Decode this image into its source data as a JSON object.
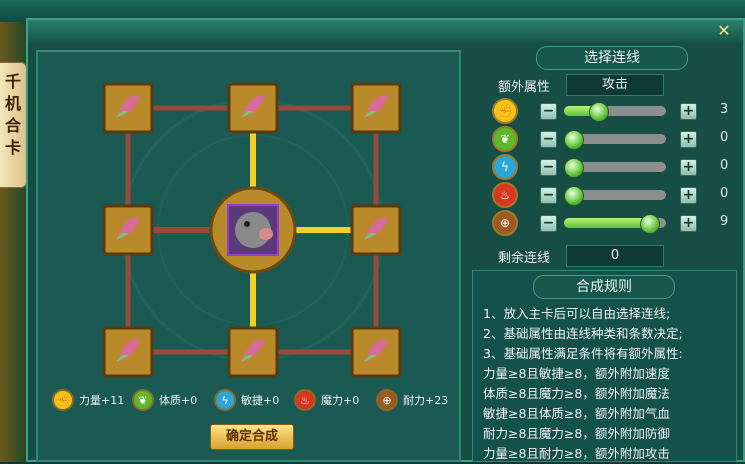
{
  "side_tab": {
    "label": "千机合卡"
  },
  "board": {
    "center_card": "pig-monster-portrait",
    "link_color": "#f4d02a"
  },
  "legend": [
    {
      "icon": "fist-icon",
      "label": "力量+11",
      "color": "#f2c21a"
    },
    {
      "icon": "leaf-icon",
      "label": "体质+0",
      "color": "#5fb82a"
    },
    {
      "icon": "lightning-icon",
      "label": "敏捷+0",
      "color": "#2aa6d8"
    },
    {
      "icon": "flame-icon",
      "label": "魔力+0",
      "color": "#d8361e"
    },
    {
      "icon": "shield-icon",
      "label": "耐力+23",
      "color": "#9a5a22"
    }
  ],
  "confirm_button": "确定合成",
  "select_links": {
    "title": "选择连线",
    "extra_attr_label": "额外属性",
    "extra_attr_value": "攻击",
    "attributes": [
      {
        "icon": "fist-icon",
        "value": "3",
        "level": 0.3
      },
      {
        "icon": "leaf-icon",
        "value": "0",
        "level": 0.0
      },
      {
        "icon": "lightning-icon",
        "value": "0",
        "level": 0.0
      },
      {
        "icon": "flame-icon",
        "value": "0",
        "level": 0.0
      },
      {
        "icon": "shield-icon",
        "value": "9",
        "level": 0.9
      }
    ],
    "remaining_label": "剩余连线",
    "remaining_value": "0"
  },
  "rules": {
    "title": "合成规则",
    "lines": [
      "1、放入主卡后可以自由选择连线;",
      "2、基础属性由连线种类和条数决定;",
      "3、基础属性满足条件将有额外属性:",
      "力量≥8且敏捷≥8，额外附加速度",
      "体质≥8且魔力≥8，额外附加魔法",
      "敏捷≥8且体质≥8，额外附加气血",
      "耐力≥8且魔力≥8，额外附加防御",
      "力量≥8且耐力≥8，额外附加攻击"
    ]
  },
  "colors": {
    "window_bg": "#164d45",
    "accent_gold": "#f4d02a",
    "frame": "#3f9f86"
  }
}
